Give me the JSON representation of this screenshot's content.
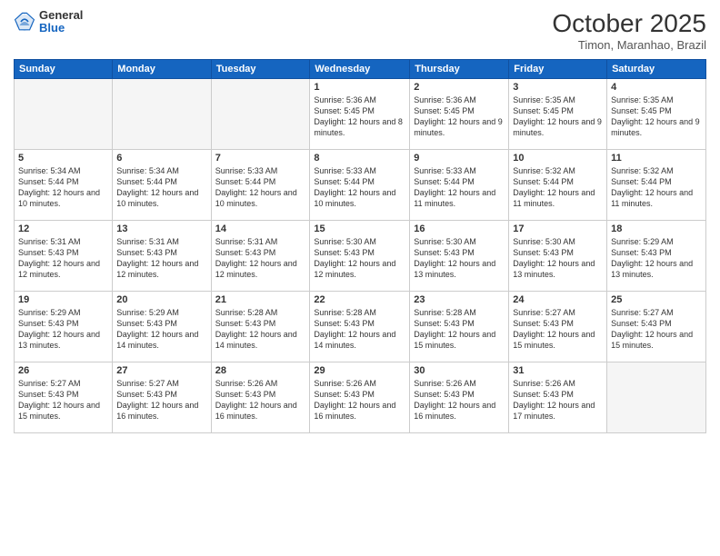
{
  "header": {
    "logo": {
      "general": "General",
      "blue": "Blue"
    },
    "title": "October 2025",
    "location": "Timon, Maranhao, Brazil"
  },
  "weekdays": [
    "Sunday",
    "Monday",
    "Tuesday",
    "Wednesday",
    "Thursday",
    "Friday",
    "Saturday"
  ],
  "weeks": [
    [
      {
        "day": "",
        "info": ""
      },
      {
        "day": "",
        "info": ""
      },
      {
        "day": "",
        "info": ""
      },
      {
        "day": "1",
        "info": "Sunrise: 5:36 AM\nSunset: 5:45 PM\nDaylight: 12 hours\nand 8 minutes."
      },
      {
        "day": "2",
        "info": "Sunrise: 5:36 AM\nSunset: 5:45 PM\nDaylight: 12 hours\nand 9 minutes."
      },
      {
        "day": "3",
        "info": "Sunrise: 5:35 AM\nSunset: 5:45 PM\nDaylight: 12 hours\nand 9 minutes."
      },
      {
        "day": "4",
        "info": "Sunrise: 5:35 AM\nSunset: 5:45 PM\nDaylight: 12 hours\nand 9 minutes."
      }
    ],
    [
      {
        "day": "5",
        "info": "Sunrise: 5:34 AM\nSunset: 5:44 PM\nDaylight: 12 hours\nand 10 minutes."
      },
      {
        "day": "6",
        "info": "Sunrise: 5:34 AM\nSunset: 5:44 PM\nDaylight: 12 hours\nand 10 minutes."
      },
      {
        "day": "7",
        "info": "Sunrise: 5:33 AM\nSunset: 5:44 PM\nDaylight: 12 hours\nand 10 minutes."
      },
      {
        "day": "8",
        "info": "Sunrise: 5:33 AM\nSunset: 5:44 PM\nDaylight: 12 hours\nand 10 minutes."
      },
      {
        "day": "9",
        "info": "Sunrise: 5:33 AM\nSunset: 5:44 PM\nDaylight: 12 hours\nand 11 minutes."
      },
      {
        "day": "10",
        "info": "Sunrise: 5:32 AM\nSunset: 5:44 PM\nDaylight: 12 hours\nand 11 minutes."
      },
      {
        "day": "11",
        "info": "Sunrise: 5:32 AM\nSunset: 5:44 PM\nDaylight: 12 hours\nand 11 minutes."
      }
    ],
    [
      {
        "day": "12",
        "info": "Sunrise: 5:31 AM\nSunset: 5:43 PM\nDaylight: 12 hours\nand 12 minutes."
      },
      {
        "day": "13",
        "info": "Sunrise: 5:31 AM\nSunset: 5:43 PM\nDaylight: 12 hours\nand 12 minutes."
      },
      {
        "day": "14",
        "info": "Sunrise: 5:31 AM\nSunset: 5:43 PM\nDaylight: 12 hours\nand 12 minutes."
      },
      {
        "day": "15",
        "info": "Sunrise: 5:30 AM\nSunset: 5:43 PM\nDaylight: 12 hours\nand 12 minutes."
      },
      {
        "day": "16",
        "info": "Sunrise: 5:30 AM\nSunset: 5:43 PM\nDaylight: 12 hours\nand 13 minutes."
      },
      {
        "day": "17",
        "info": "Sunrise: 5:30 AM\nSunset: 5:43 PM\nDaylight: 12 hours\nand 13 minutes."
      },
      {
        "day": "18",
        "info": "Sunrise: 5:29 AM\nSunset: 5:43 PM\nDaylight: 12 hours\nand 13 minutes."
      }
    ],
    [
      {
        "day": "19",
        "info": "Sunrise: 5:29 AM\nSunset: 5:43 PM\nDaylight: 12 hours\nand 13 minutes."
      },
      {
        "day": "20",
        "info": "Sunrise: 5:29 AM\nSunset: 5:43 PM\nDaylight: 12 hours\nand 14 minutes."
      },
      {
        "day": "21",
        "info": "Sunrise: 5:28 AM\nSunset: 5:43 PM\nDaylight: 12 hours\nand 14 minutes."
      },
      {
        "day": "22",
        "info": "Sunrise: 5:28 AM\nSunset: 5:43 PM\nDaylight: 12 hours\nand 14 minutes."
      },
      {
        "day": "23",
        "info": "Sunrise: 5:28 AM\nSunset: 5:43 PM\nDaylight: 12 hours\nand 15 minutes."
      },
      {
        "day": "24",
        "info": "Sunrise: 5:27 AM\nSunset: 5:43 PM\nDaylight: 12 hours\nand 15 minutes."
      },
      {
        "day": "25",
        "info": "Sunrise: 5:27 AM\nSunset: 5:43 PM\nDaylight: 12 hours\nand 15 minutes."
      }
    ],
    [
      {
        "day": "26",
        "info": "Sunrise: 5:27 AM\nSunset: 5:43 PM\nDaylight: 12 hours\nand 15 minutes."
      },
      {
        "day": "27",
        "info": "Sunrise: 5:27 AM\nSunset: 5:43 PM\nDaylight: 12 hours\nand 16 minutes."
      },
      {
        "day": "28",
        "info": "Sunrise: 5:26 AM\nSunset: 5:43 PM\nDaylight: 12 hours\nand 16 minutes."
      },
      {
        "day": "29",
        "info": "Sunrise: 5:26 AM\nSunset: 5:43 PM\nDaylight: 12 hours\nand 16 minutes."
      },
      {
        "day": "30",
        "info": "Sunrise: 5:26 AM\nSunset: 5:43 PM\nDaylight: 12 hours\nand 16 minutes."
      },
      {
        "day": "31",
        "info": "Sunrise: 5:26 AM\nSunset: 5:43 PM\nDaylight: 12 hours\nand 17 minutes."
      },
      {
        "day": "",
        "info": ""
      }
    ]
  ]
}
